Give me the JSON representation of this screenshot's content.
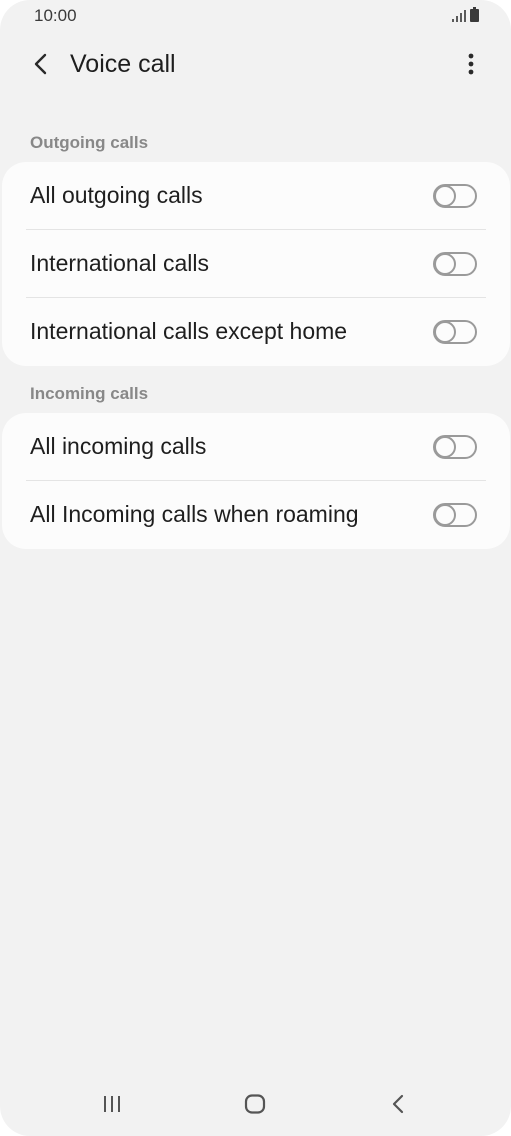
{
  "status_bar": {
    "time": "10:00",
    "icons": [
      "signal-icon",
      "battery-icon"
    ]
  },
  "app_bar": {
    "title": "Voice call",
    "back_icon": "back-arrow-icon",
    "more_icon": "more-vertical-icon"
  },
  "sections": [
    {
      "header": "Outgoing calls",
      "items": [
        {
          "label": "All outgoing calls",
          "enabled": false
        },
        {
          "label": "International calls",
          "enabled": false
        },
        {
          "label": "International calls except home",
          "enabled": false
        }
      ]
    },
    {
      "header": "Incoming calls",
      "items": [
        {
          "label": "All incoming calls",
          "enabled": false
        },
        {
          "label": "All Incoming calls when roaming",
          "enabled": false
        }
      ]
    }
  ],
  "nav_bar": {
    "icons": [
      "recent-apps-icon",
      "home-icon",
      "back-icon"
    ]
  },
  "colors": {
    "background": "#f2f2f2",
    "card": "#fcfcfc",
    "section_header": "#888888",
    "text": "#1e1e1e",
    "toggle_off": "#9a9a9a"
  }
}
